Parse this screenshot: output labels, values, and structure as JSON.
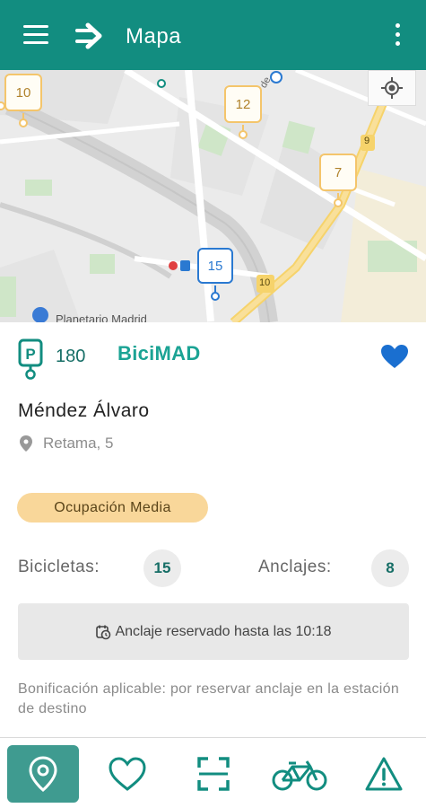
{
  "appbar": {
    "title": "Mapa",
    "icons": {
      "menu": "menu-icon",
      "logo": "bicimad-arrow-logo",
      "more": "more-vert-icon"
    },
    "color": "#128d80"
  },
  "map": {
    "markers": [
      {
        "label": "10",
        "selected": false
      },
      {
        "label": "12",
        "selected": false
      },
      {
        "label": "7",
        "selected": false
      },
      {
        "label": "15",
        "selected": true
      }
    ],
    "road_labels": [
      "9",
      "10"
    ],
    "place_label": "Planetario Madrid",
    "street_fragment": "de",
    "locate_icon": "my-location-icon"
  },
  "station": {
    "dock_count": "180",
    "brand": "BiciMAD",
    "name": "Méndez Álvaro",
    "address": "Retama, 5",
    "occupancy": "Ocupación Media",
    "bikes_label": "Bicicletas:",
    "bikes_value": "15",
    "docks_label": "Anclajes:",
    "docks_value": "8",
    "reservation": "Anclaje reservado hasta las 10:18",
    "bonus": "Bonificación aplicable: por reservar anclaje en la estación de destino",
    "favorite": true,
    "colors": {
      "accent": "#128d80",
      "heart": "#1a6fd0",
      "occupancy": "#f9d79a"
    }
  },
  "bottomnav": {
    "items": [
      {
        "name": "map-pin-icon",
        "active": true
      },
      {
        "name": "heart-outline-icon",
        "active": false
      },
      {
        "name": "scan-qr-icon",
        "active": false
      },
      {
        "name": "bicycle-icon",
        "active": false
      },
      {
        "name": "warning-icon",
        "active": false
      }
    ]
  }
}
